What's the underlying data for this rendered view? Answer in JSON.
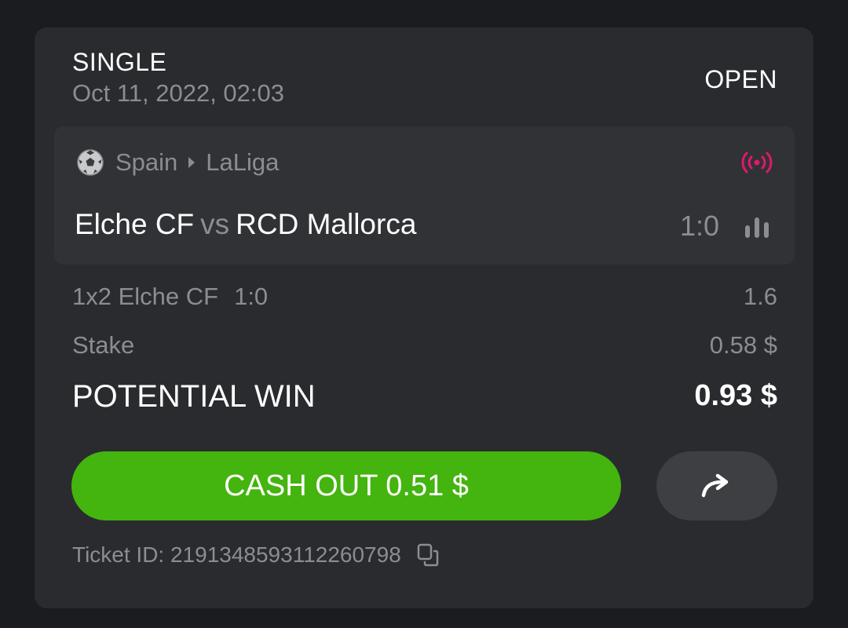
{
  "bet": {
    "type": "SINGLE",
    "date": "Oct 11, 2022, 02:03",
    "status": "OPEN"
  },
  "event": {
    "sport_icon": "soccer-ball-icon",
    "country": "Spain",
    "league": "LaLiga",
    "live_icon": "live-broadcast-icon",
    "live_color": "#e0196b",
    "home_team": "Elche CF",
    "vs": "vs",
    "away_team": "RCD Mallorca",
    "score": "1:0",
    "stats_icon": "stats-bars-icon"
  },
  "selection": {
    "market": "1x2 Elche CF",
    "score": "1:0",
    "odds": "1.6"
  },
  "stake": {
    "label": "Stake",
    "value": "0.58 $"
  },
  "potential_win": {
    "label": "POTENTIAL WIN",
    "value": "0.93 $"
  },
  "actions": {
    "cashout_label": "CASH OUT 0.51 $",
    "cashout_color": "#44b40e",
    "share_icon": "share-arrow-icon"
  },
  "ticket": {
    "label": "Ticket ID: 2191348593112260798",
    "copy_icon": "copy-icon"
  }
}
